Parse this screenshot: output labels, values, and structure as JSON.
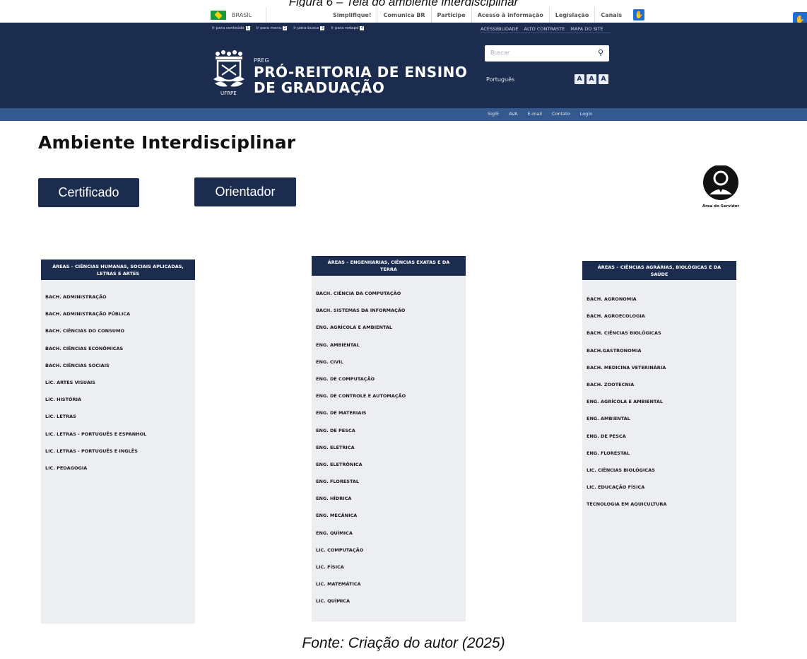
{
  "figure_caption_top": "Figura 6 – Tela do ambiente interdisciplinar",
  "figure_caption_bottom": "Fonte: Criação do autor (2025)",
  "gov_bar": {
    "country": "BRASIL",
    "links": [
      "Simplifique!",
      "Comunica BR",
      "Participe",
      "Acesso à informação",
      "Legislação",
      "Canais"
    ]
  },
  "header": {
    "accessibility_shortcuts": [
      {
        "label": "Ir para conteúdo",
        "key": "1"
      },
      {
        "label": "Ir para menu",
        "key": "2"
      },
      {
        "label": "Ir para busca",
        "key": "3"
      },
      {
        "label": "Ir para rodapé",
        "key": "4"
      }
    ],
    "top_links": [
      "ACESSIBILIDADE",
      "ALTO CONTRASTE",
      "MAPA DO SITE"
    ],
    "preg": "PREG",
    "title_line1": "PRÓ-REITORIA DE ENSINO",
    "title_line2": "DE GRADUAÇÃO",
    "logo_text": "UFRPE",
    "search_placeholder": "Buscar",
    "language": "Português",
    "font_buttons": [
      "A",
      "A",
      "A"
    ],
    "bottom_links": [
      "SigIE",
      "AVA",
      "E-mail",
      "Contato",
      "Login"
    ]
  },
  "main": {
    "title": "Ambiente Interdisciplinar",
    "certificado_button": "Certificado",
    "orientador_button": "Orientador",
    "servidor_label": "Área do Servidor"
  },
  "areas": [
    {
      "heading": "ÁREAS – CIÊNCIAS HUMANAS, SOCIAIS APLICADAS, LETRAS E ARTES",
      "courses": [
        "BACH. ADMINISTRAÇÃO",
        "BACH. ADMINISTRAÇÃO PÚBLICA",
        "BACH. CIÊNCIAS DO CONSUMO",
        "BACH. CIÊNCIAS ECONÔMICAS",
        "BACH. CIÊNCIAS SOCIAIS",
        "LIC. ARTES VISUAIS",
        "LIC. HISTÓRIA",
        "LIC. LETRAS",
        "LIC. LETRAS - PORTUGUÊS E ESPANHOL",
        "LIC. LETRAS - PORTUGUÊS E  INGLÊS",
        "LIC. PEDAGOGIA"
      ]
    },
    {
      "heading": "ÁREAS – ENGENHARIAS, CIÊNCIAS EXATAS E DA TERRA",
      "courses": [
        "BACH. CIÊNCIA DA COMPUTAÇÃO",
        "BACH. SISTEMAS DA INFORMAÇÃO",
        "ENG. AGRÍCOLA E AMBIENTAL",
        "ENG. AMBIENTAL",
        "ENG. CIVIL",
        "ENG. DE COMPUTAÇÃO",
        "ENG. DE CONTROLE E AUTOMAÇÃO",
        "ENG. DE MATERIAIS",
        "ENG. DE PESCA",
        "ENG. ELÉTRICA",
        "ENG. ELETRÔNICA",
        "ENG. FLORESTAL",
        "ENG. HÍDRICA",
        "ENG. MECÂNICA",
        "ENG. QUÍMICA",
        "LIC. COMPUTAÇÃO",
        "LIC. FÍSICA",
        "LIC. MATEMÁTICA",
        "LIC. QUÍMICA"
      ]
    },
    {
      "heading": "ÁREAS – CIÊNCIAS AGRÁRIAS, BIOLÓGICAS E DA SAÚDE",
      "courses": [
        "BACH. AGRONOMIA",
        "BACH. AGROECOLOGIA",
        "BACH. CIÊNCIAS BIOLÓGICAS",
        "BACH.GASTRONOMIA",
        "BACH. MEDICINA VETERINÁRIA",
        "BACH. ZOOTECNIA",
        "ENG. AGRÍCOLA E AMBIENTAL",
        "ENG. AMBIENTAL",
        "ENG. DE PESCA",
        "ENG. FLORESTAL",
        "LIC. CIÊNCIAS BIOLÓGICAS",
        "LIC. EDUCAÇÃO FÍSICA",
        "TECNOLOGIA EM AQUICULTURA"
      ]
    }
  ]
}
